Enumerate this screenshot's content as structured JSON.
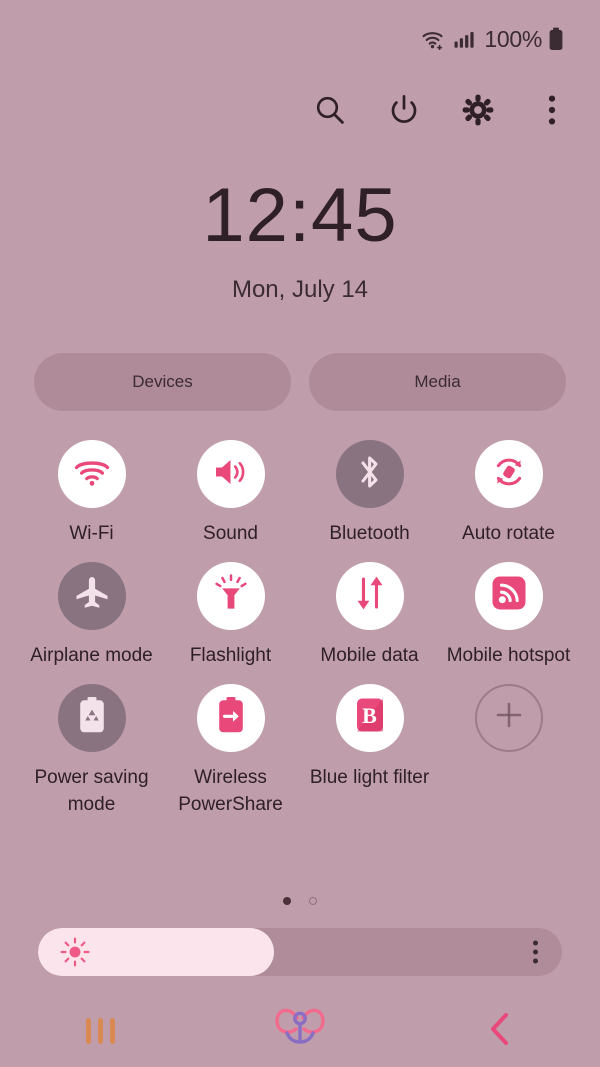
{
  "statusbar": {
    "wifi_icon": "wifi-signal-icon",
    "cellular_icon": "cellular-signal-icon",
    "battery_percent": "100%",
    "battery_icon": "battery-full-icon"
  },
  "toolbar": {
    "buttons": [
      {
        "name": "search-button",
        "icon": "search-icon"
      },
      {
        "name": "power-button",
        "icon": "power-icon"
      },
      {
        "name": "settings-button",
        "icon": "gear-icon"
      },
      {
        "name": "overflow-button",
        "icon": "three-dot-menu-icon"
      }
    ]
  },
  "clock": {
    "time": "12:45",
    "date": "Mon, July 14"
  },
  "pills": [
    {
      "label": "Devices",
      "name": "devices-pill"
    },
    {
      "label": "Media",
      "name": "media-pill"
    }
  ],
  "tiles": [
    {
      "label": "Wi-Fi",
      "icon": "wifi-icon",
      "state": "on"
    },
    {
      "label": "Sound",
      "icon": "sound-speaker-icon",
      "state": "on"
    },
    {
      "label": "Bluetooth",
      "icon": "bluetooth-icon",
      "state": "off"
    },
    {
      "label": "Auto rotate",
      "icon": "auto-rotate-icon",
      "state": "on"
    },
    {
      "label": "Airplane mode",
      "icon": "airplane-icon",
      "state": "off"
    },
    {
      "label": "Flashlight",
      "icon": "flashlight-icon",
      "state": "on"
    },
    {
      "label": "Mobile data",
      "icon": "mobile-data-arrows-icon",
      "state": "on"
    },
    {
      "label": "Mobile hotspot",
      "icon": "hotspot-icon",
      "state": "on"
    },
    {
      "label": "Power saving mode",
      "icon": "battery-recycle-icon",
      "state": "off"
    },
    {
      "label": "Wireless PowerShare",
      "icon": "battery-share-icon",
      "state": "on"
    },
    {
      "label": "Blue light filter",
      "icon": "blue-light-b-icon",
      "state": "on"
    },
    {
      "label": "",
      "icon": "plus-icon",
      "state": "add"
    }
  ],
  "pagination": {
    "total": 2,
    "active_index": 0
  },
  "brightness": {
    "value_percent": 45,
    "sun_icon": "brightness-sun-icon",
    "menu_icon": "three-dot-menu-icon"
  },
  "navbar": [
    {
      "name": "recents-button",
      "icon": "recents-bars-icon"
    },
    {
      "name": "home-button",
      "icon": "bow-ribbon-home-icon"
    },
    {
      "name": "back-button",
      "icon": "back-chevron-icon"
    }
  ],
  "colors": {
    "background": "#c09dab",
    "accent_pink": "#e8487a",
    "tile_on_bg": "#ffffff",
    "tile_off_bg": "#8a7380",
    "text_dark": "#2e2026",
    "recents_orange": "#d98a52",
    "home_purple": "#8a6ec4",
    "home_pink": "#f26a8d"
  }
}
